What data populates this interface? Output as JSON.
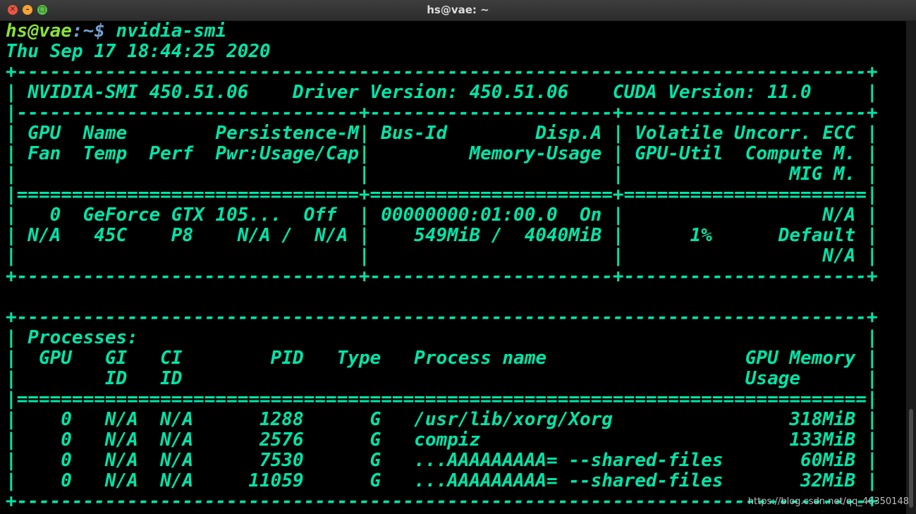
{
  "window": {
    "title": "hs@vae: ~",
    "close_glyph": "✕",
    "min_glyph": "–",
    "max_glyph": "□"
  },
  "prompt": {
    "user": "hs@vae",
    "separator": ":",
    "path": "~",
    "symbol": "$",
    "command": " nvidia-smi"
  },
  "output": [
    "Thu Sep 17 18:44:25 2020",
    "+-----------------------------------------------------------------------------+",
    "| NVIDIA-SMI 450.51.06    Driver Version: 450.51.06    CUDA Version: 11.0     |",
    "|-------------------------------+----------------------+----------------------+",
    "| GPU  Name        Persistence-M| Bus-Id        Disp.A | Volatile Uncorr. ECC |",
    "| Fan  Temp  Perf  Pwr:Usage/Cap|         Memory-Usage | GPU-Util  Compute M. |",
    "|                               |                      |               MIG M. |",
    "|===============================+======================+======================|",
    "|   0  GeForce GTX 105...  Off  | 00000000:01:00.0  On |                  N/A |",
    "| N/A   45C    P8    N/A /  N/A |    549MiB /  4040MiB |      1%      Default |",
    "|                               |                      |                  N/A |",
    "+-------------------------------+----------------------+----------------------+",
    "",
    "+-----------------------------------------------------------------------------+",
    "| Processes:                                                                  |",
    "|  GPU   GI   CI        PID   Type   Process name                  GPU Memory |",
    "|        ID   ID                                                   Usage      |",
    "|=============================================================================|",
    "|    0   N/A  N/A      1288      G   /usr/lib/xorg/Xorg                318MiB |",
    "|    0   N/A  N/A      2576      G   compiz                            133MiB |",
    "|    0   N/A  N/A      7530      G   ...AAAAAAAAA= --shared-files       60MiB |",
    "|    0   N/A  N/A     11059      G   ...AAAAAAAAA= --shared-files       32MiB |",
    "+-----------------------------------------------------------------------------+"
  ],
  "watermark": "https://blog.csdn.net/qq_46350148"
}
